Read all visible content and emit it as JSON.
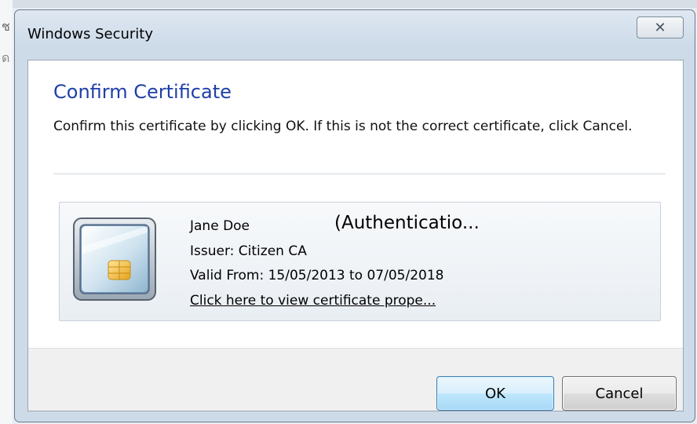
{
  "window": {
    "title": "Windows Security",
    "close_glyph": "✕"
  },
  "dialog": {
    "heading": "Confirm Certificate",
    "description": "Confirm this certificate by clicking OK. If this is not the correct certificate, click Cancel."
  },
  "certificate": {
    "icon": "smart-card-icon",
    "name": "Jane Doe",
    "type": "(Authenticatio...",
    "issuer": "Issuer: Citizen CA",
    "validity": "Valid From: 15/05/2013 to 07/05/2018",
    "link": "Click here to view certificate prope..."
  },
  "buttons": {
    "ok": "OK",
    "cancel": "Cancel"
  },
  "background": {
    "glyph1": "ช",
    "glyph2": "ด"
  },
  "colors": {
    "heading": "#1f3fa8",
    "ok_border": "#3c7fb1",
    "frame": "#cddbe9"
  }
}
